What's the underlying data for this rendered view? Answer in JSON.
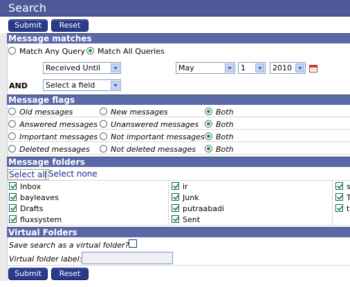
{
  "header": {
    "title": "Search"
  },
  "toolbar": {
    "submit_label": "Submit",
    "reset_label": "Reset"
  },
  "sections": {
    "matches": "Message matches",
    "flags": "Message flags",
    "folders": "Message folders",
    "virtual": "Virtual Folders"
  },
  "matches": {
    "any_label": "Match Any Query",
    "all_label": "Match All Queries",
    "field1": "Received Until",
    "month": "May",
    "day": "1",
    "year": "2010",
    "and_label": "AND",
    "field2": "Select a field"
  },
  "flags": [
    {
      "a": "Old messages",
      "b": "New messages",
      "c": "Both"
    },
    {
      "a": "Answered messages",
      "b": "Unanswered messages",
      "c": "Both"
    },
    {
      "a": "Important messages",
      "b": "Not important messages",
      "c": "Both"
    },
    {
      "a": "Deleted messages",
      "b": "Not deleted messages",
      "c": "Both"
    }
  ],
  "folders": {
    "select_all": "Select all",
    "separator": "|",
    "select_none": "Select none",
    "col1": [
      "Inbox",
      "bayleaves",
      "Drafts",
      "fluxsystem"
    ],
    "col2": [
      "ir",
      "Junk",
      "putraabadi",
      "Sent"
    ],
    "col3": [
      "s",
      "T",
      "tr"
    ]
  },
  "virtual": {
    "save_label": "Save search as a virtual folder?",
    "label_label": "Virtual folder label:",
    "label_value": ""
  }
}
